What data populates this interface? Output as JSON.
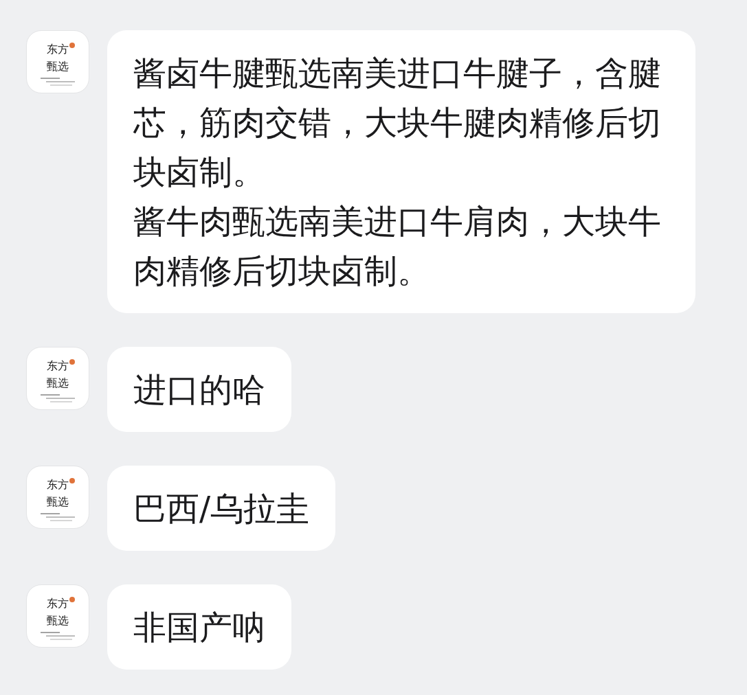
{
  "messages": [
    {
      "avatar": {
        "logo_text": "东方甄选"
      },
      "paragraphs": [
        "酱卤牛腱甄选南美进口牛腱子，含腱芯，筋肉交错，大块牛腱肉精修后切块卤制。",
        "酱牛肉甄选南美进口牛肩肉，大块牛肉精修后切块卤制。"
      ]
    },
    {
      "avatar": {
        "logo_text": "东方甄选"
      },
      "paragraphs": [
        "进口的哈"
      ]
    },
    {
      "avatar": {
        "logo_text": "东方甄选"
      },
      "paragraphs": [
        "巴西/乌拉圭"
      ]
    },
    {
      "avatar": {
        "logo_text": "东方甄选"
      },
      "paragraphs": [
        "非国产呐"
      ]
    }
  ]
}
